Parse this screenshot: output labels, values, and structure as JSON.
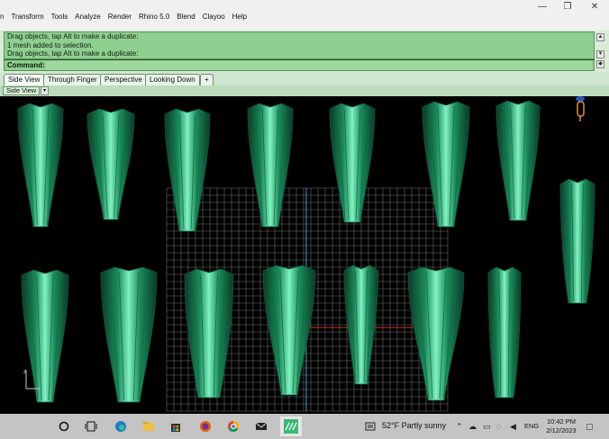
{
  "menu": [
    "n",
    "Transform",
    "Tools",
    "Analyze",
    "Render",
    "Rhino 5.0",
    "Blend",
    "Clayoo",
    "Help"
  ],
  "window_buttons": {
    "minimize": "—",
    "restore": "❐",
    "close": "✕"
  },
  "command_history": [
    "Drag objects, tap Alt to make a duplicate:",
    "1 mesh added to selection.",
    "Drag objects, tap Alt to make a duplicate:"
  ],
  "command_label": "Command:",
  "tabs": [
    "Side View",
    "Through Finger",
    "Perspective",
    "Looking Down"
  ],
  "tab_add": "+",
  "viewport": {
    "label": "Side View",
    "dropdown": "▾",
    "axis_label": "z"
  },
  "taskbar": {
    "weather": "52°F  Partly sunny",
    "language": "ENG",
    "time": "10:42 PM",
    "date": "2/12/2023"
  },
  "colors": {
    "mesh": "#1a8a5a",
    "mesh_highlight": "#7ff0c0",
    "grid": "#6e6e6e",
    "axis_red": "#c83030",
    "axis_cyan": "#40a0c0"
  }
}
